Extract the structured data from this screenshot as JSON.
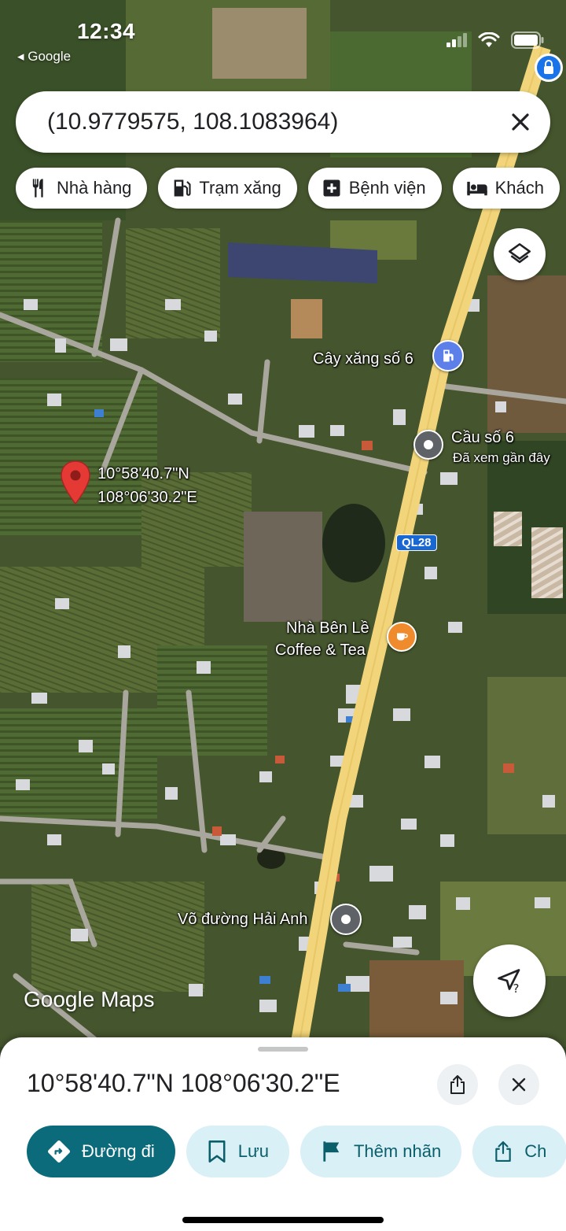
{
  "status_bar": {
    "time": "12:34",
    "back_app": "◂ Google",
    "icons": [
      "signal-icon",
      "wifi-icon",
      "battery-icon"
    ]
  },
  "search": {
    "query": "(10.9779575, 108.1083964)",
    "clear_icon": "close-icon"
  },
  "chips": [
    {
      "label": "Nhà hàng",
      "icon": "restaurant-icon"
    },
    {
      "label": "Trạm xăng",
      "icon": "gas-station-icon"
    },
    {
      "label": "Bệnh viện",
      "icon": "hospital-icon"
    },
    {
      "label": "Khách",
      "icon": "hotel-icon"
    }
  ],
  "map": {
    "pin": {
      "lat_label": "10°58'40.7\"N",
      "lng_label": "108°06'30.2\"E"
    },
    "places": {
      "gas_station": "Cây xăng số 6",
      "bridge": "Cầu số 6",
      "bridge_sub": "Đã xem gần đây",
      "cafe_line1": "Nhà Bên Lề",
      "cafe_line2": "Coffee & Tea",
      "martial": "Võ đường Hải Anh"
    },
    "route_shield": "QL28",
    "logo": "Google Maps",
    "colors": {
      "road": "#f2d57a",
      "poi_gas": "#5c7fea",
      "poi_cafe": "#ef8b2c",
      "poi_seen": "#5f6368"
    }
  },
  "sheet": {
    "title": "10°58'40.7\"N 108°06'30.2\"E",
    "share_icon": "share-icon",
    "close_icon": "close-icon",
    "actions": [
      {
        "label": "Đường đi",
        "icon": "directions-icon",
        "primary": true
      },
      {
        "label": "Lưu",
        "icon": "bookmark-icon"
      },
      {
        "label": "Thêm nhãn",
        "icon": "flag-icon"
      },
      {
        "label": "Ch",
        "icon": "share-icon"
      }
    ],
    "accent": "#0b6b7a"
  }
}
